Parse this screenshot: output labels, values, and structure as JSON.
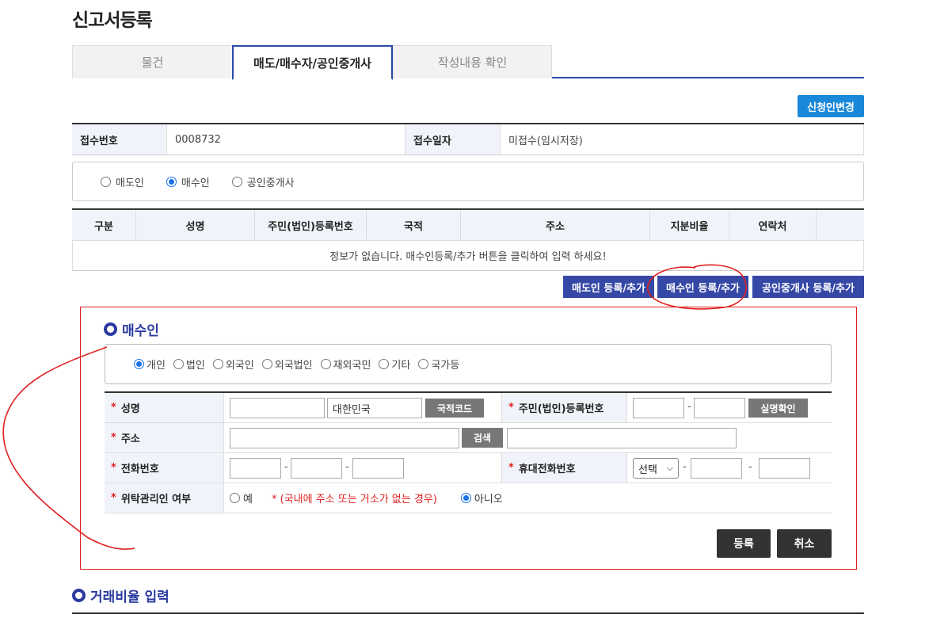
{
  "page": {
    "title": "신고서등록"
  },
  "tabs": [
    {
      "label": "물건",
      "active": false
    },
    {
      "label": "매도/매수자/공인중개사",
      "active": true
    },
    {
      "label": "작성내용 확인",
      "active": false
    }
  ],
  "buttons": {
    "change_applicant": "신청인변경",
    "add_seller": "매도인 등록/추가",
    "add_buyer": "매수인 등록/추가",
    "add_broker": "공인중개사 등록/추가",
    "nationality_code": "국적코드",
    "verify_name": "실명확인",
    "search": "검색",
    "register": "등록",
    "cancel": "취소"
  },
  "receipt": {
    "number_label": "접수번호",
    "number_value": "0008732",
    "date_label": "접수일자",
    "date_value": "미접수(임시저장)"
  },
  "party_type": {
    "options": [
      "매도인",
      "매수인",
      "공인중개사"
    ],
    "selected": "매수인"
  },
  "party_list": {
    "columns": [
      "구분",
      "성명",
      "주민(법인)등록번호",
      "국적",
      "주소",
      "지분비율",
      "연락처"
    ],
    "empty_message": "정보가 없습니다.   매수인등록/추가 버튼을 클릭하여 입력 하세요!"
  },
  "buyer_section": {
    "title": "매수인",
    "types": [
      "개인",
      "법인",
      "외국인",
      "외국법인",
      "재외국민",
      "기타",
      "국가등"
    ],
    "selected_type": "개인",
    "fields": {
      "name_label": "성명",
      "nationality_value": "대한민국",
      "rrn_label": "주민(법인)등록번호",
      "address_label": "주소",
      "phone_label": "전화번호",
      "mobile_label": "휴대전화번호",
      "mobile_select": "선택",
      "trustee_label": "위탁관리인 여부",
      "trustee_yes": "예",
      "trustee_note": "* (국내에 주소 또는 거소가 없는 경우)",
      "trustee_no": "아니오",
      "trustee_selected": "아니오",
      "required_mark": "*",
      "dash": "-"
    }
  },
  "trade_ratio_section": {
    "title": "거래비율 입력"
  },
  "colors": {
    "accent": "#2b4aa8",
    "primary_button": "#1a88d8",
    "navy_button": "#3548a6",
    "annotation": "#e02020"
  }
}
